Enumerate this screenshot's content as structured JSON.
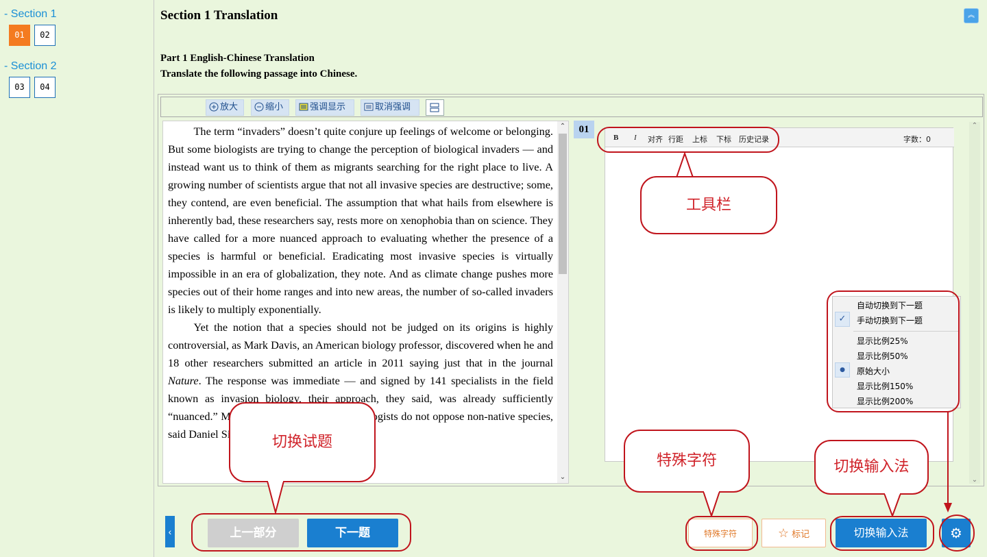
{
  "sidebar": {
    "sections": [
      {
        "title": "- Section 1",
        "questions": [
          "01",
          "02"
        ],
        "active": "01"
      },
      {
        "title": "- Section 2",
        "questions": [
          "03",
          "04"
        ]
      }
    ]
  },
  "header": {
    "title": "Section 1 Translation",
    "part_title": "Part 1 English-Chinese Translation",
    "instruction": "Translate the following passage into Chinese."
  },
  "toolbar": {
    "zoom_in": "放大",
    "zoom_out": "缩小",
    "highlight": "强调显示",
    "unhighlight": "取消强调"
  },
  "passage": {
    "p1": "The term “invaders” doesn’t quite conjure up feelings of welcome or belonging. But some biologists are trying to change the perception of biological invaders — and instead want us to think of them as migrants searching for the right place to live. A growing number of scientists argue that not all invasive species are destructive; some, they contend, are even beneficial. The assumption that what hails from elsewhere is inherently bad, these researchers say, rests more on xenophobia than on science. They have called for a more nuanced approach to evaluating whether the presence of a species is harmful or beneficial. Eradicating most invasive species is virtually impossible in an era of globalization, they note. And as climate change pushes more species out of their home ranges and into new areas, the number of so-called invaders is likely to multiply exponentially.",
    "p2_a": "Yet the notion that a species should not be judged on its origins is highly controversial, as Mark Davis, an American biology professor, discovered when he and 18 other researchers submitted an article in 2011 saying just that in the journal ",
    "p2_journal": "Nature",
    "p2_b": ". The response was immediate — and signed by 141 specialists in the field known as invasion biology, their approach, they said, was already sufficiently “nuanced.” Most invasion biologists and ecologists do not oppose non-native species, said Daniel Simberloff, a professor of"
  },
  "answer": {
    "question_number": "01",
    "tools": [
      "B",
      "I",
      "对齐",
      "行距",
      "上标",
      "下标",
      "历史记录"
    ],
    "word_count_label": "字数：0"
  },
  "settings_menu": {
    "items": [
      "自动切换到下一题",
      "手动切换到下一题",
      "显示比例25%",
      "显示比例50%",
      "原始大小",
      "显示比例150%",
      "显示比例200%"
    ],
    "checked": "手动切换到下一题",
    "selected": "原始大小"
  },
  "bottom": {
    "prev_label": "上一部分",
    "next_label": "下一题",
    "special_label": "特殊字符",
    "mark_label": "标记",
    "ime_label": "切换输入法"
  },
  "annotations": {
    "toolbar": "工具栏",
    "switch_question": "切换试题",
    "special_chars": "特殊字符",
    "switch_ime": "切换输入法"
  },
  "colors": {
    "page_bg": "#eaf6dd",
    "accent_blue": "#1a7fd0",
    "active_orange": "#f47b20",
    "annotation_red": "#c0141c"
  }
}
